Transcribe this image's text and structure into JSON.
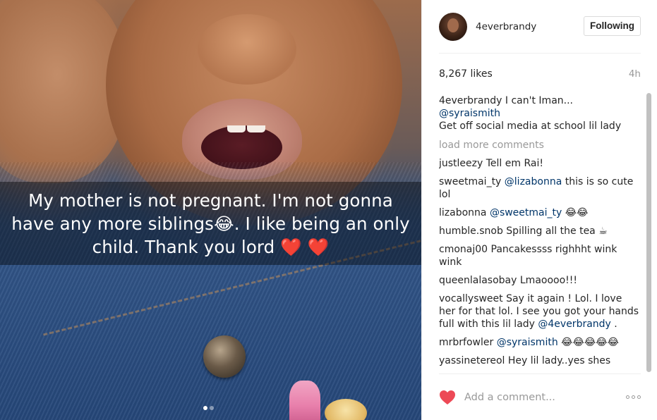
{
  "photo": {
    "caption": "My mother is not pregnant. I'm not gonna have any more siblings😂. I like being an only child. Thank you lord ❤️ ❤️",
    "carousel_dots": 2,
    "carousel_active": 1
  },
  "header": {
    "username": "4everbrandy",
    "follow_label": "Following"
  },
  "meta": {
    "likes": "8,267 likes",
    "time": "4h"
  },
  "caption_comment": {
    "user": "4everbrandy",
    "text": "I can't Iman...",
    "mention": "@syraismith",
    "text2": "Get off social media at school lil lady"
  },
  "load_more": "load more comments",
  "comments": [
    {
      "user": "justleezy",
      "parts": [
        {
          "t": "Tell em Rai!"
        }
      ]
    },
    {
      "user": "sweetmai_ty",
      "parts": [
        {
          "m": "@lizabonna"
        },
        {
          "t": " this is so cute lol"
        }
      ]
    },
    {
      "user": "lizabonna",
      "parts": [
        {
          "m": "@sweetmai_ty"
        },
        {
          "t": " 😂😂"
        }
      ]
    },
    {
      "user": "humble.snob",
      "parts": [
        {
          "t": "Spilling all the tea ☕"
        }
      ]
    },
    {
      "user": "cmonaj00",
      "parts": [
        {
          "t": "Pancakessss righhht wink wink"
        }
      ]
    },
    {
      "user": "queenlalasobay",
      "parts": [
        {
          "t": "Lmaoooo!!!"
        }
      ]
    },
    {
      "user": "vocallysweet",
      "parts": [
        {
          "t": "Say it again ! Lol. I love her for that lol. I see you got your hands full with this lil lady "
        },
        {
          "m": "@4everbrandy"
        },
        {
          "t": " ."
        }
      ]
    },
    {
      "user": "mrbrfowler",
      "parts": [
        {
          "m": "@syraismith"
        },
        {
          "t": " 😂😂😂😂😂"
        }
      ]
    },
    {
      "user": "yassinetereol",
      "parts": [
        {
          "t": "Hey lil lady..yes shes"
        }
      ]
    }
  ],
  "footer": {
    "comment_placeholder": "Add a comment...",
    "heart_color": "#ed4956"
  },
  "colors": {
    "mention": "#003569",
    "muted": "#999999",
    "text": "#262626"
  }
}
